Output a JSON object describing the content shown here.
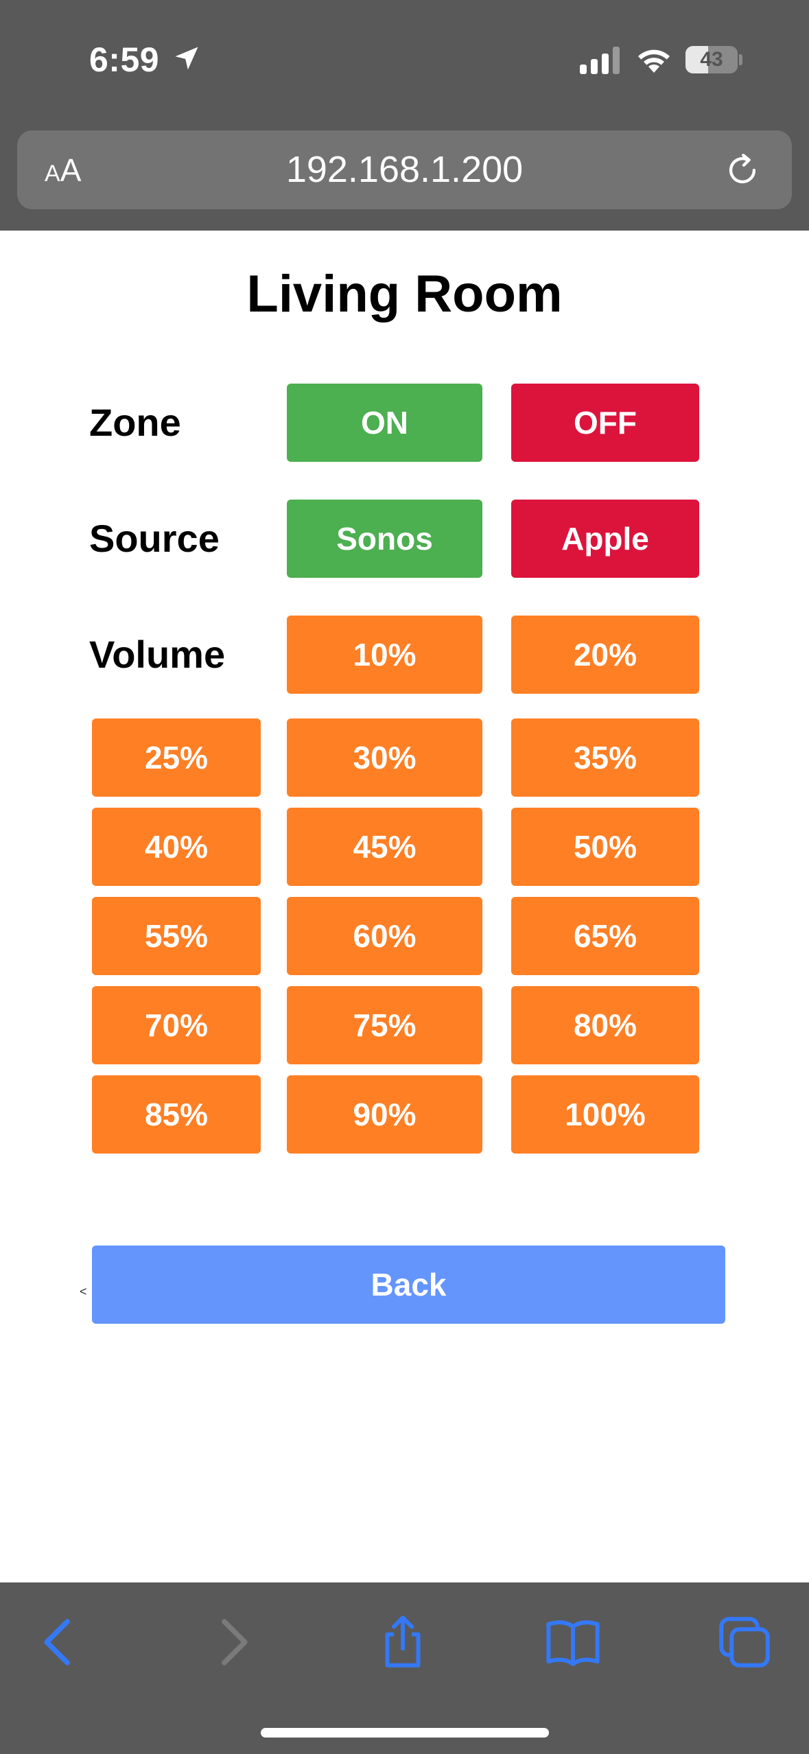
{
  "status_bar": {
    "time": "6:59",
    "battery_level": "43",
    "battery_fraction": 0.43,
    "icons": [
      "location-arrow-icon",
      "signal-icon",
      "wifi-icon",
      "battery-icon"
    ]
  },
  "address_bar": {
    "text_size_small": "A",
    "text_size_large": "A",
    "url": "192.168.1.200",
    "reload_icon": "reload-icon"
  },
  "page": {
    "title": "Living Room",
    "zone": {
      "label": "Zone",
      "on": "ON",
      "off": "OFF"
    },
    "source": {
      "label": "Source",
      "option1": "Sonos",
      "option2": "Apple"
    },
    "volume": {
      "label": "Volume",
      "row1": [
        "10%",
        "20%"
      ],
      "grid": [
        [
          "25%",
          "30%",
          "35%"
        ],
        [
          "40%",
          "45%",
          "50%"
        ],
        [
          "55%",
          "60%",
          "65%"
        ],
        [
          "70%",
          "75%",
          "80%"
        ],
        [
          "85%",
          "90%",
          "100%"
        ]
      ]
    },
    "back_caret": "<",
    "back": "Back"
  },
  "toolbar": {
    "items": [
      "back-arrow-icon",
      "forward-arrow-icon",
      "share-icon",
      "bookmarks-icon",
      "tabs-icon"
    ]
  },
  "colors": {
    "chrome": "#595959",
    "address_bar": "#737373",
    "green": "#4caf50",
    "red": "#dc143c",
    "orange": "#ff7f24",
    "back": "#6495fd",
    "toolbar_icon": "#3478f6"
  }
}
